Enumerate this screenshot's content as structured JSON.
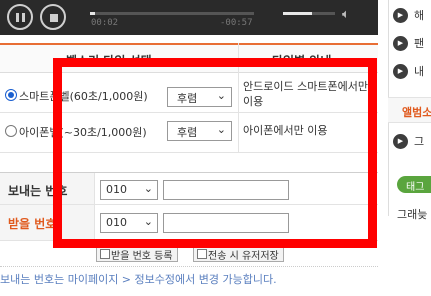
{
  "player": {
    "time_elapsed": "00:02",
    "time_remaining": "-00:57",
    "progress": 0.03,
    "volume": 0.55,
    "pause_icon": "pause-icon",
    "stop_icon": "stop-icon",
    "volume_icon": "volume-icon"
  },
  "table": {
    "headers": [
      "벨소리 타입 선택",
      "타입별 안내"
    ],
    "options": [
      {
        "label": "스마트폰벨(60초/1,000원)",
        "select_value": "후렴",
        "info": "안드로이드 스마트폰에서만 이용",
        "selected": true
      },
      {
        "label": "아이폰벨(~30초/1,000원)",
        "select_value": "후렴",
        "info": "아이폰에서만 이용",
        "selected": false
      }
    ]
  },
  "form": {
    "sender_label": "보내는 번호",
    "sender_prefix": "010",
    "receiver_label": "받을 번호",
    "receiver_prefix": "010",
    "button_add": "받을 번호 등록",
    "button_save": "전송 시 유저저장"
  },
  "note": "보내는 번호는 마이페이지 > 정보수정에서 변경 가능합니다.",
  "sidebar": {
    "items": [
      "해",
      "팬",
      "내"
    ],
    "album_label": "앨범소",
    "item_after_album": "그",
    "tag_label": "태그",
    "small_text": "그래늦"
  },
  "colors": {
    "accent_orange": "#e86e35",
    "highlight_red": "#ff0000",
    "tag_green": "#5aa53e",
    "note_blue": "#5a7fbf"
  }
}
